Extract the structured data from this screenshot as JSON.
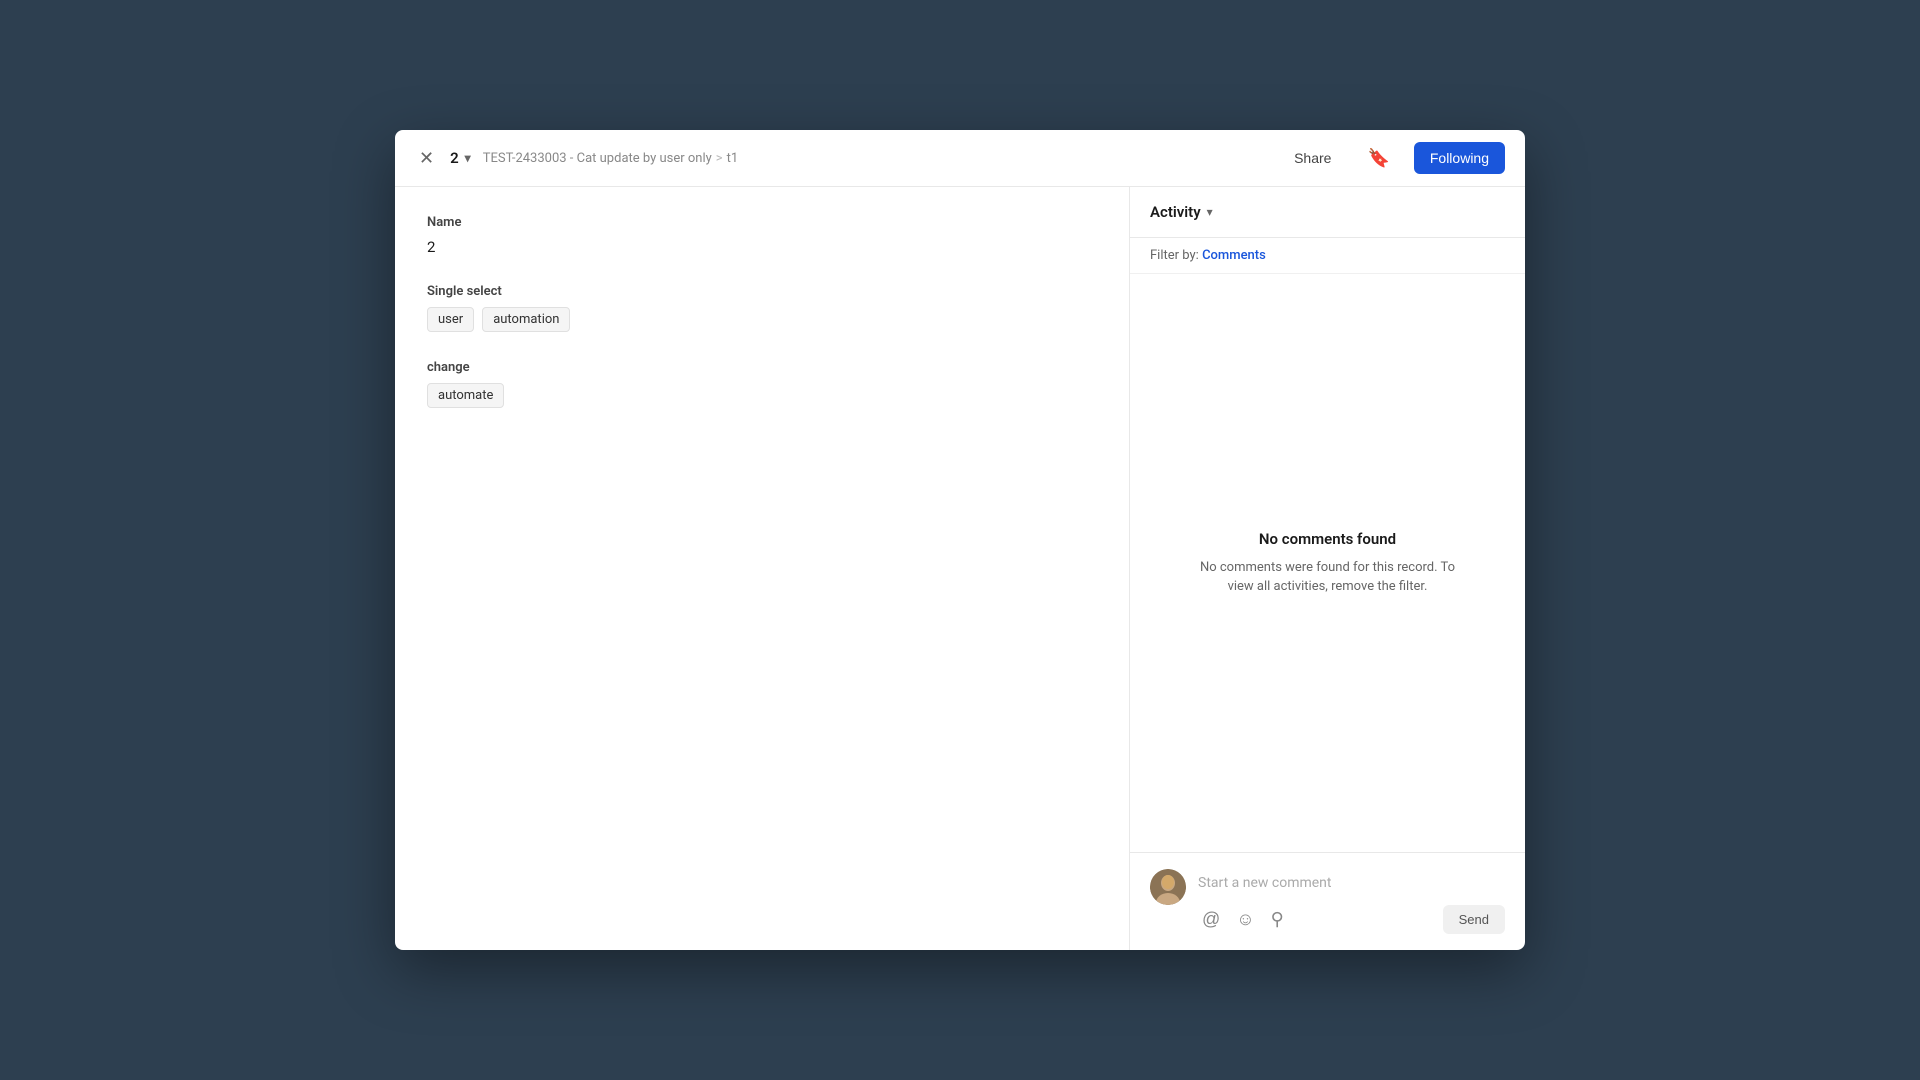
{
  "header": {
    "close_label": "✕",
    "record_number": "2",
    "chevron": "▾",
    "breadcrumb_main": "TEST-2433003 - Cat update by user only",
    "breadcrumb_separator": ">",
    "breadcrumb_child": "t1",
    "share_label": "Share",
    "following_label": "Following"
  },
  "main": {
    "fields": [
      {
        "label": "Name",
        "type": "text",
        "value": "2"
      },
      {
        "label": "Single select",
        "type": "tags",
        "tags": [
          "user",
          "automation"
        ]
      },
      {
        "label": "change",
        "type": "tags",
        "tags": [
          "automate"
        ]
      }
    ]
  },
  "activity": {
    "title": "Activity",
    "chevron": "▾",
    "filter_prefix": "Filter by:",
    "filter_link": "Comments",
    "no_comments_title": "No comments found",
    "no_comments_desc": "No comments were found for this record. To view all activities, remove the filter.",
    "comment_placeholder": "Start a new comment",
    "send_label": "Send",
    "tools": {
      "mention": "@",
      "emoji": "☺",
      "attachment": "⚲"
    }
  },
  "colors": {
    "following_bg": "#1a56db",
    "following_text": "#ffffff",
    "tag_bg": "#f5f5f5",
    "tag_border": "#e0e0e0"
  }
}
